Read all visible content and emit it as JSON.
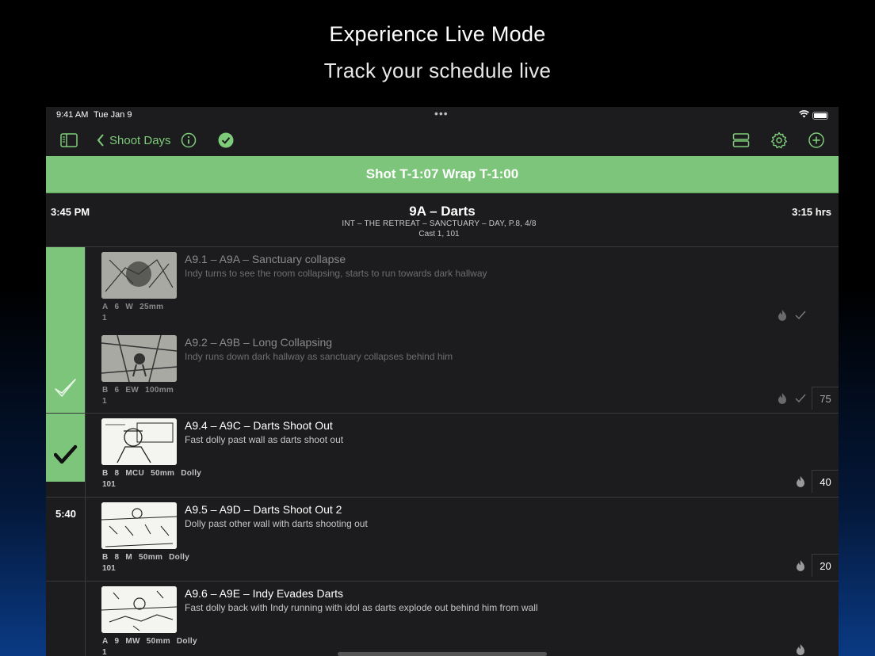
{
  "promo": {
    "title": "Experience Live Mode",
    "subtitle": "Track your schedule live"
  },
  "status_bar": {
    "time": "9:41 AM",
    "date": "Tue Jan 9"
  },
  "toolbar": {
    "back_label": "Shoot Days",
    "icons": [
      "sidebar-icon",
      "info-icon",
      "checkmark-circle-icon",
      "rows-icon",
      "gear-icon",
      "plus-circle-icon"
    ],
    "accent_color": "#7ecb7a"
  },
  "banner": {
    "text": "Shot T-1:07  Wrap T-1:00",
    "color": "#7dc57a"
  },
  "scene": {
    "start_time": "3:45 PM",
    "title": "9A – Darts",
    "location": "INT – THE RETREAT – SANCTUARY – DAY, P.8, 4/8",
    "cast": "Cast 1, 101",
    "duration": "3:15 hrs"
  },
  "shots": [
    {
      "title": "A9.1 – A9A – Sanctuary collapse",
      "description": "Indy turns to see the room collapsing, starts to run towards dark hallway",
      "camera": "A",
      "setup": "6",
      "size": "W",
      "lens": "25mm",
      "rig": "",
      "cast": "1",
      "minutes": "",
      "done": true
    },
    {
      "title": "A9.2 – A9B – Long Collapsing",
      "description": "Indy runs down dark hallway as sanctuary collapses behind him",
      "camera": "B",
      "setup": "6",
      "size": "EW",
      "lens": "100mm",
      "rig": "",
      "cast": "1",
      "minutes": "75",
      "done": true
    },
    {
      "title": "A9.4 – A9C – Darts Shoot Out",
      "description": "Fast dolly past wall as darts shoot out",
      "camera": "B",
      "setup": "8",
      "size": "MCU",
      "lens": "50mm",
      "rig": "Dolly",
      "cast": "101",
      "minutes": "40",
      "done": false
    },
    {
      "title": "A9.5 – A9D – Darts Shoot Out 2",
      "description": "Dolly past other wall with darts shooting out",
      "camera": "B",
      "setup": "8",
      "size": "M",
      "lens": "50mm",
      "rig": "Dolly",
      "cast": "101",
      "minutes": "20",
      "done": false
    },
    {
      "title": "A9.6 – A9E – Indy Evades Darts",
      "description": "Fast dolly back with Indy running with idol as darts explode out behind him from wall",
      "camera": "A",
      "setup": "9",
      "size": "MW",
      "lens": "50mm",
      "rig": "Dolly",
      "cast": "1",
      "minutes": "",
      "done": false
    }
  ],
  "gutter": {
    "next_time": "5:40"
  }
}
